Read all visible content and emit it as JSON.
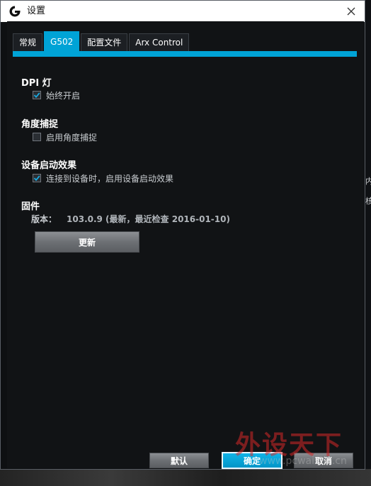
{
  "window": {
    "title": "设置"
  },
  "background": {
    "right_marks": [
      "内",
      "核"
    ]
  },
  "tabs": [
    {
      "label": "常规",
      "active": false
    },
    {
      "label": "G502",
      "active": true
    },
    {
      "label": "配置文件",
      "active": false
    },
    {
      "label": "Arx Control",
      "active": false
    }
  ],
  "sections": {
    "dpi": {
      "title": "DPI 灯",
      "option_label": "始终开启",
      "checked": true
    },
    "angle": {
      "title": "角度捕捉",
      "option_label": "启用角度捕捉",
      "checked": false
    },
    "startup": {
      "title": "设备启动效果",
      "option_label": "连接到设备时，启用设备启动效果",
      "checked": true
    },
    "firmware": {
      "title": "固件",
      "version_label": "版本：",
      "version_value": "103.0.9 (最新，最近检查 2016-01-10)",
      "update_button": "更新"
    }
  },
  "footer": {
    "default_button": "默认",
    "ok_button": "确定",
    "cancel_button": "取消"
  },
  "watermark": {
    "main": "外设天下",
    "sub": "www.pcwaishe.cn"
  },
  "colors": {
    "accent": "#00a3d6",
    "background": "#111315",
    "titlebar": "#ffffff"
  }
}
